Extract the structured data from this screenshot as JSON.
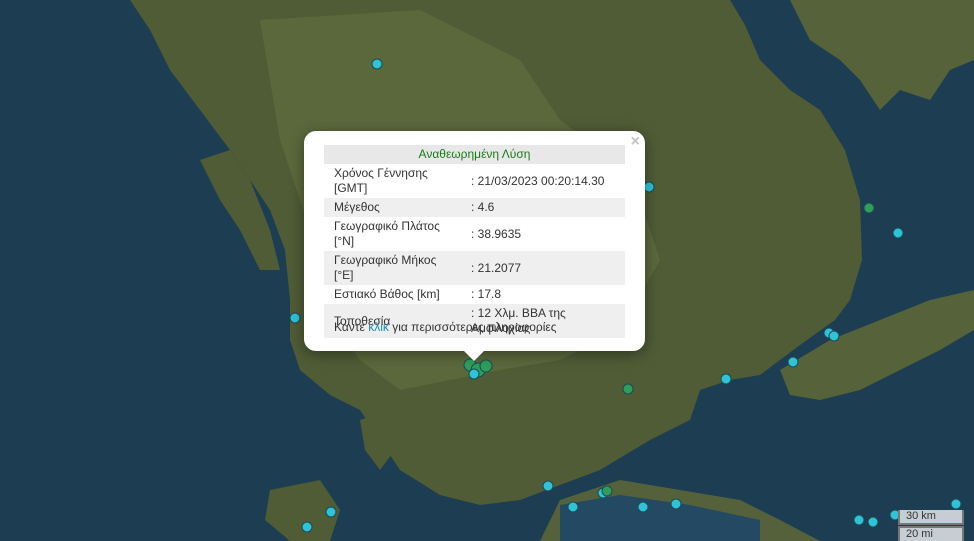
{
  "popup": {
    "title": "Αναθεωρημένη Λύση",
    "rows": [
      {
        "label": "Χρόνος Γέννησης [GMT]",
        "value": ": 21/03/2023 00:20:14.30"
      },
      {
        "label": "Μέγεθος",
        "value": ": 4.6"
      },
      {
        "label": "Γεωγραφικό Πλάτος [°N]",
        "value": ": 38.9635"
      },
      {
        "label": "Γεωγραφικό Μήκος [°E]",
        "value": ": 21.2077"
      },
      {
        "label": "Εστιακό Βάθος [km]",
        "value": ": 17.8"
      },
      {
        "label": "Τοποθεσία",
        "value": ": 12 Χλμ. ΒΒΑ της Αμφιλοχίας"
      }
    ],
    "footer_prefix": "Κάντε ",
    "footer_link": "κλικ",
    "footer_suffix": " για περισσότερες πληροφορίες",
    "close_symbol": "×"
  },
  "scale": {
    "km": "30 km",
    "mi": "20 mi"
  },
  "colors": {
    "marker_cyan": "#2ec3d6",
    "marker_green": "#2e9e5a",
    "sea": "#1c3a4f",
    "land": "#4d5a33"
  }
}
